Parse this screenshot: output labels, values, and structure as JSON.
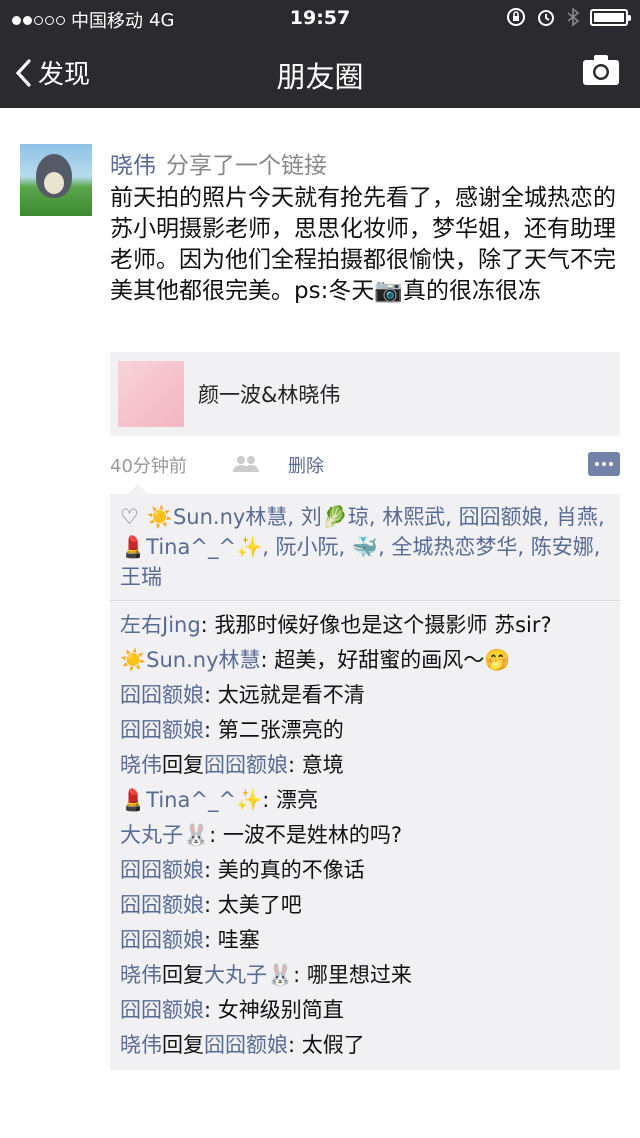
{
  "status": {
    "carrier": "中国移动",
    "network": "4G",
    "time": "19:57"
  },
  "nav": {
    "back": "发现",
    "title": "朋友圈"
  },
  "post": {
    "author": "晓伟",
    "action": "分享了一个链接",
    "text": "前天拍的照片今天就有抢先看了，感谢全城热恋的苏小明摄影老师，思思化妆师，梦华姐，还有助理老师。因为他们全程拍摄都很愉快，除了天气不完美其他都很完美。ps:冬天📷真的很冻很冻",
    "link_title": "颜一波&林晓伟",
    "time_ago": "40分钟前",
    "delete_label": "删除"
  },
  "likes": [
    "☀️Sun.ny林慧",
    "刘🥬琼",
    "林熙武",
    "囧囧额娘",
    "肖燕",
    "💄Tina^_^✨",
    "阮小阮",
    "🐳",
    "全城热恋梦华",
    "陈安娜",
    "王瑞"
  ],
  "comments": [
    {
      "who": "左右Jing",
      "to": "",
      "text": "我那时候好像也是这个摄影师 苏sir?"
    },
    {
      "who": "☀️Sun.ny林慧",
      "to": "",
      "text": "超美，好甜蜜的画风～🤭"
    },
    {
      "who": "囧囧额娘",
      "to": "",
      "text": "太远就是看不清"
    },
    {
      "who": "囧囧额娘",
      "to": "",
      "text": "第二张漂亮的"
    },
    {
      "who": "晓伟",
      "to": "囧囧额娘",
      "text": "意境"
    },
    {
      "who": "💄Tina^_^✨",
      "to": "",
      "text": "漂亮"
    },
    {
      "who": "大丸子🐰",
      "to": "",
      "text": "一波不是姓林的吗?"
    },
    {
      "who": "囧囧额娘",
      "to": "",
      "text": "美的真的不像话"
    },
    {
      "who": "囧囧额娘",
      "to": "",
      "text": "太美了吧"
    },
    {
      "who": "囧囧额娘",
      "to": "",
      "text": "哇塞"
    },
    {
      "who": "晓伟",
      "to": "大丸子🐰",
      "text": "哪里想过来"
    },
    {
      "who": "囧囧额娘",
      "to": "",
      "text": "女神级别简直"
    },
    {
      "who": "晓伟",
      "to": "囧囧额娘",
      "text": "太假了"
    }
  ],
  "reply_word": "回复",
  "colors": {
    "link": "#576b95",
    "header": "#2b2b2f",
    "panel": "#f1f1f3"
  }
}
